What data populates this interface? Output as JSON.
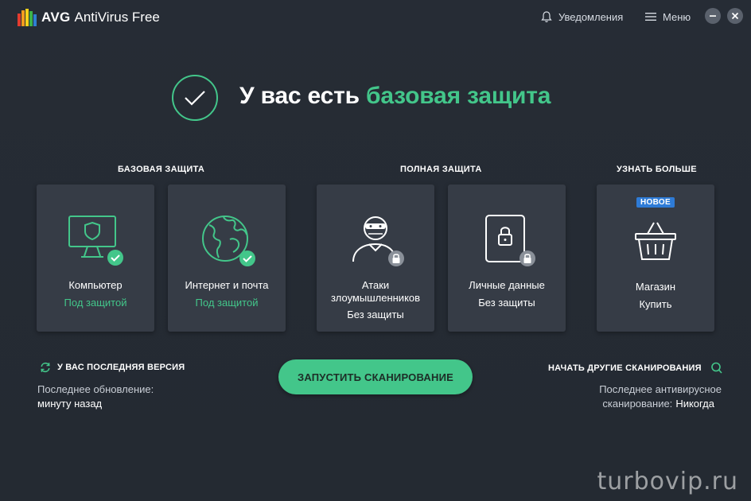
{
  "app": {
    "brand_bold": "AVG",
    "brand_rest": "AntiVirus Free"
  },
  "titlebar": {
    "notifications_label": "Уведомления",
    "menu_label": "Меню"
  },
  "hero": {
    "title_prefix": "У вас есть",
    "title_accent": "базовая защита"
  },
  "sections": {
    "basic": "БАЗОВАЯ ЗАЩИТА",
    "full": "ПОЛНАЯ ЗАЩИТА",
    "more": "УЗНАТЬ БОЛЬШЕ"
  },
  "cards": [
    {
      "title": "Компьютер",
      "status": "Под защитой",
      "icon": "monitor-shield-icon",
      "protected": true
    },
    {
      "title": "Интернет и почта",
      "status": "Под защитой",
      "icon": "globe-icon",
      "protected": true
    },
    {
      "title": "Атаки злоумышленников",
      "status": "Без защиты",
      "icon": "hacker-icon",
      "protected": false
    },
    {
      "title": "Личные данные",
      "status": "Без защиты",
      "icon": "locked-document-icon",
      "protected": false
    },
    {
      "title": "Магазин",
      "status": "Купить",
      "icon": "shopping-basket-icon",
      "badge": "НОВОЕ"
    }
  ],
  "update": {
    "heading": "У ВАС ПОСЛЕДНЯЯ ВЕРСИЯ",
    "label": "Последнее обновление:",
    "value": "минуту назад"
  },
  "scan_button": "ЗАПУСТИТЬ СКАНИРОВАНИЕ",
  "other_scans": {
    "heading": "НАЧАТЬ ДРУГИЕ СКАНИРОВАНИЯ",
    "label_line1": "Последнее антивирусное",
    "label_line2": "сканирование:",
    "value": "Никогда"
  },
  "watermark": "turbovip.ru",
  "colors": {
    "accent": "#43c68a",
    "background": "#252b34",
    "card": "#363c46",
    "badge": "#2e7bd6",
    "lock_badge": "#8a9099"
  }
}
